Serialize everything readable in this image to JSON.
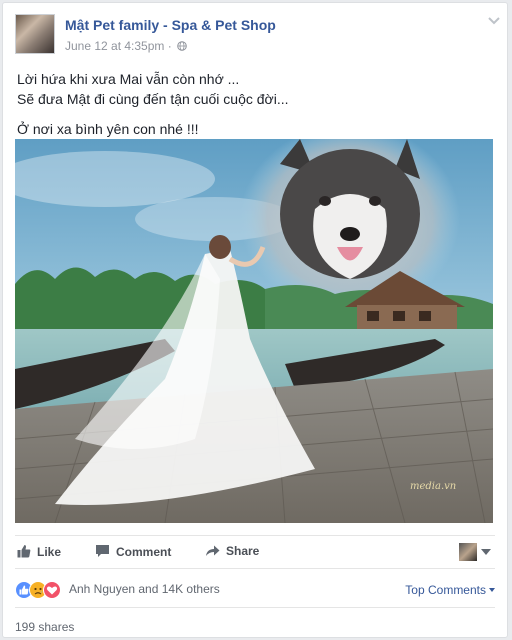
{
  "post": {
    "page_name": "Mật Pet family - Spa & Pet Shop",
    "timestamp": "June 12 at 4:35pm",
    "privacy_icon": "globe-icon",
    "lines": [
      "Lời hứa khi xưa Mai vẫn còn nhớ ...",
      "Sẽ đưa Mật đi cùng đến tận cuối cuộc đời...",
      "Ở nơi xa bình yên con nhé !!!"
    ],
    "photo_watermark": "media.vn"
  },
  "actions": {
    "like": "Like",
    "comment": "Comment",
    "share": "Share"
  },
  "reactions": {
    "summary": "Anh Nguyen and 14K others",
    "top_comments": "Top Comments",
    "icons": [
      "like-reaction-icon",
      "sad-reaction-icon",
      "love-reaction-icon"
    ],
    "colors": {
      "like": "#5890ff",
      "sad": "#f7b125",
      "love": "#f25268"
    }
  },
  "shares": "199 shares",
  "colors": {
    "link": "#365899",
    "meta": "#90949c",
    "action_text": "#4b4f56"
  }
}
